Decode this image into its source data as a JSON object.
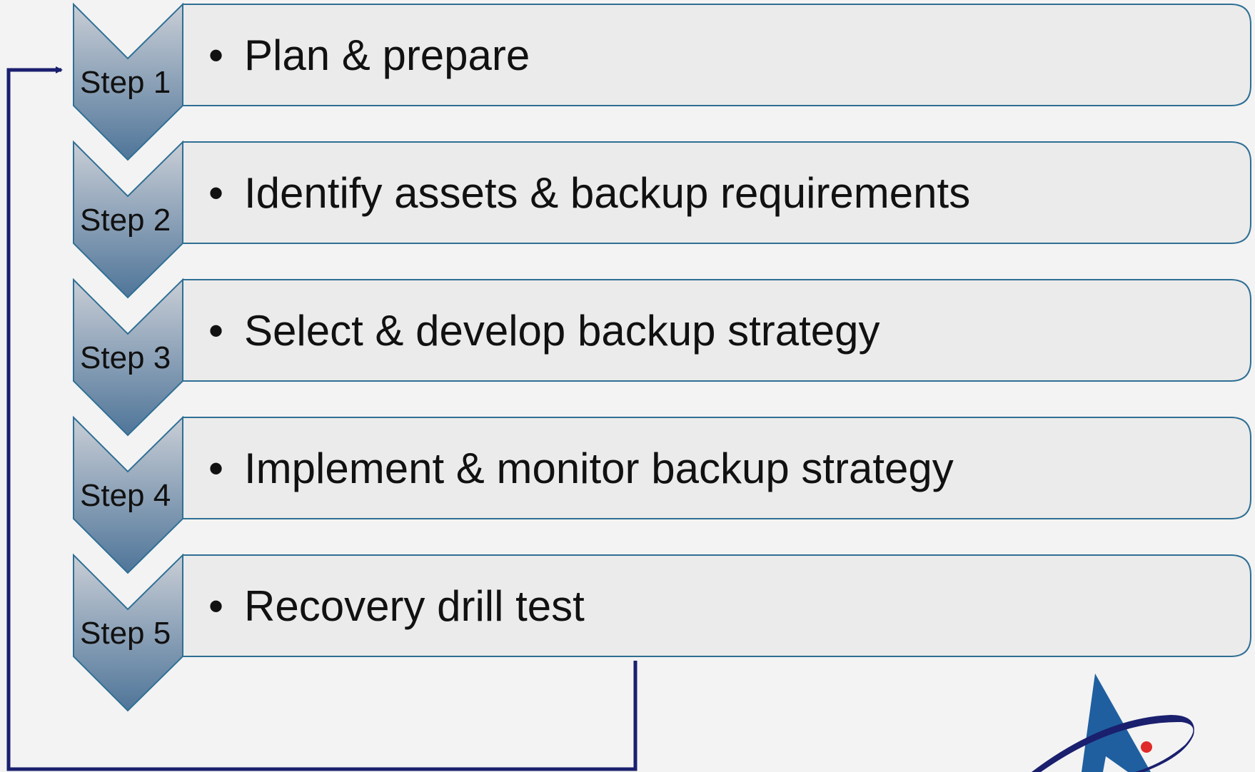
{
  "colors": {
    "background": "#f3f3f3",
    "box_fill": "#ebebeb",
    "box_stroke": "#2f6f94",
    "chevron_top": "#c9ced6",
    "chevron_bottom": "#4f7599",
    "chevron_stroke": "#2f6f94",
    "loop_arrow": "#1a1f6e",
    "logo_blue": "#1f5f9f",
    "logo_dark": "#1a1f6e",
    "logo_red": "#e02b2b"
  },
  "steps": [
    {
      "label": "Step 1",
      "text": "Plan & prepare"
    },
    {
      "label": "Step 2",
      "text": "Identify assets & backup requirements"
    },
    {
      "label": "Step 3",
      "text": "Select & develop backup strategy"
    },
    {
      "label": "Step 4",
      "text": "Implement & monitor backup strategy"
    },
    {
      "label": "Step 5",
      "text": "Recovery drill test"
    }
  ],
  "bullet": "•",
  "loop": {
    "from": "Step 5",
    "to": "Step 1"
  },
  "logo": {
    "icon": "company-logo-icon"
  }
}
